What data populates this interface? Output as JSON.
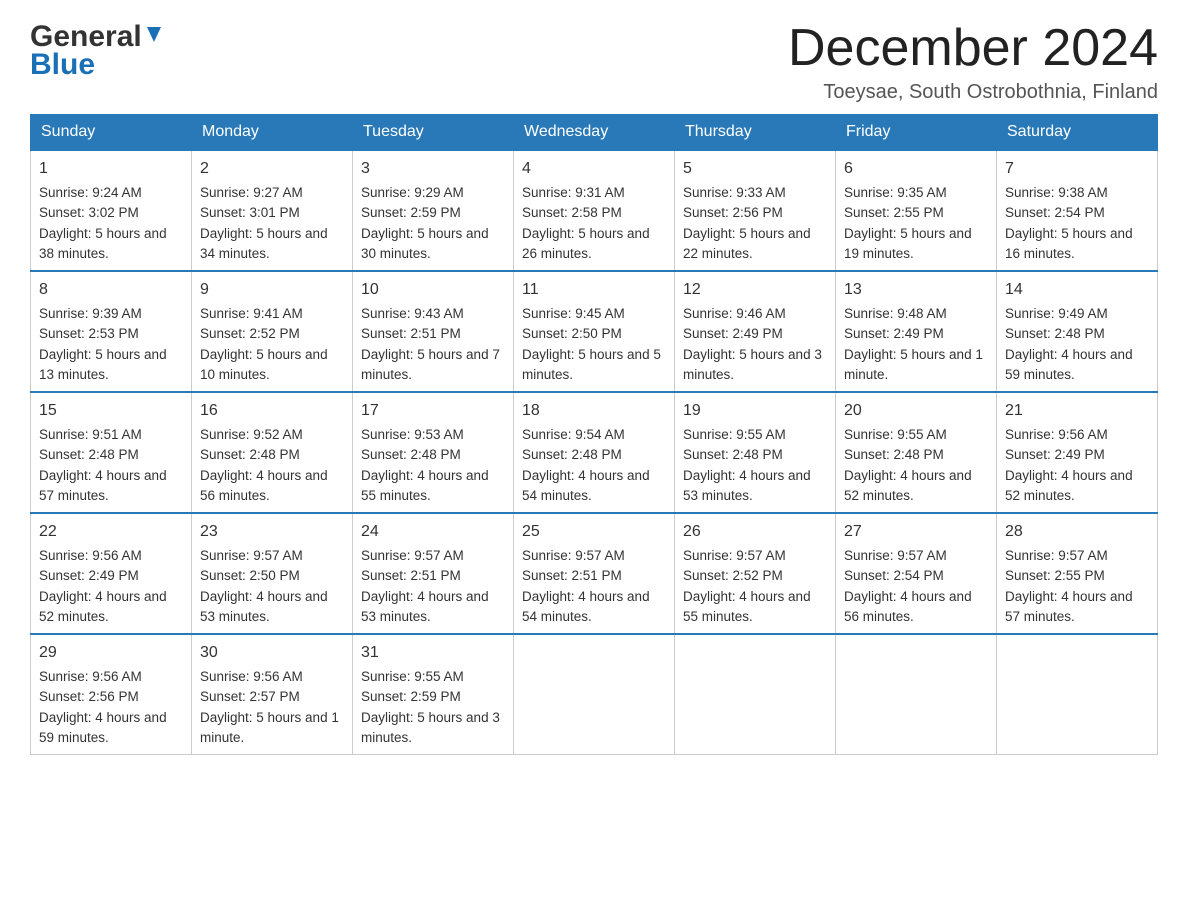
{
  "header": {
    "logo_general": "General",
    "logo_blue": "Blue",
    "month_title": "December 2024",
    "location": "Toeysae, South Ostrobothnia, Finland"
  },
  "days_of_week": [
    "Sunday",
    "Monday",
    "Tuesday",
    "Wednesday",
    "Thursday",
    "Friday",
    "Saturday"
  ],
  "weeks": [
    [
      {
        "day": "1",
        "sunrise": "9:24 AM",
        "sunset": "3:02 PM",
        "daylight": "5 hours and 38 minutes."
      },
      {
        "day": "2",
        "sunrise": "9:27 AM",
        "sunset": "3:01 PM",
        "daylight": "5 hours and 34 minutes."
      },
      {
        "day": "3",
        "sunrise": "9:29 AM",
        "sunset": "2:59 PM",
        "daylight": "5 hours and 30 minutes."
      },
      {
        "day": "4",
        "sunrise": "9:31 AM",
        "sunset": "2:58 PM",
        "daylight": "5 hours and 26 minutes."
      },
      {
        "day": "5",
        "sunrise": "9:33 AM",
        "sunset": "2:56 PM",
        "daylight": "5 hours and 22 minutes."
      },
      {
        "day": "6",
        "sunrise": "9:35 AM",
        "sunset": "2:55 PM",
        "daylight": "5 hours and 19 minutes."
      },
      {
        "day": "7",
        "sunrise": "9:38 AM",
        "sunset": "2:54 PM",
        "daylight": "5 hours and 16 minutes."
      }
    ],
    [
      {
        "day": "8",
        "sunrise": "9:39 AM",
        "sunset": "2:53 PM",
        "daylight": "5 hours and 13 minutes."
      },
      {
        "day": "9",
        "sunrise": "9:41 AM",
        "sunset": "2:52 PM",
        "daylight": "5 hours and 10 minutes."
      },
      {
        "day": "10",
        "sunrise": "9:43 AM",
        "sunset": "2:51 PM",
        "daylight": "5 hours and 7 minutes."
      },
      {
        "day": "11",
        "sunrise": "9:45 AM",
        "sunset": "2:50 PM",
        "daylight": "5 hours and 5 minutes."
      },
      {
        "day": "12",
        "sunrise": "9:46 AM",
        "sunset": "2:49 PM",
        "daylight": "5 hours and 3 minutes."
      },
      {
        "day": "13",
        "sunrise": "9:48 AM",
        "sunset": "2:49 PM",
        "daylight": "5 hours and 1 minute."
      },
      {
        "day": "14",
        "sunrise": "9:49 AM",
        "sunset": "2:48 PM",
        "daylight": "4 hours and 59 minutes."
      }
    ],
    [
      {
        "day": "15",
        "sunrise": "9:51 AM",
        "sunset": "2:48 PM",
        "daylight": "4 hours and 57 minutes."
      },
      {
        "day": "16",
        "sunrise": "9:52 AM",
        "sunset": "2:48 PM",
        "daylight": "4 hours and 56 minutes."
      },
      {
        "day": "17",
        "sunrise": "9:53 AM",
        "sunset": "2:48 PM",
        "daylight": "4 hours and 55 minutes."
      },
      {
        "day": "18",
        "sunrise": "9:54 AM",
        "sunset": "2:48 PM",
        "daylight": "4 hours and 54 minutes."
      },
      {
        "day": "19",
        "sunrise": "9:55 AM",
        "sunset": "2:48 PM",
        "daylight": "4 hours and 53 minutes."
      },
      {
        "day": "20",
        "sunrise": "9:55 AM",
        "sunset": "2:48 PM",
        "daylight": "4 hours and 52 minutes."
      },
      {
        "day": "21",
        "sunrise": "9:56 AM",
        "sunset": "2:49 PM",
        "daylight": "4 hours and 52 minutes."
      }
    ],
    [
      {
        "day": "22",
        "sunrise": "9:56 AM",
        "sunset": "2:49 PM",
        "daylight": "4 hours and 52 minutes."
      },
      {
        "day": "23",
        "sunrise": "9:57 AM",
        "sunset": "2:50 PM",
        "daylight": "4 hours and 53 minutes."
      },
      {
        "day": "24",
        "sunrise": "9:57 AM",
        "sunset": "2:51 PM",
        "daylight": "4 hours and 53 minutes."
      },
      {
        "day": "25",
        "sunrise": "9:57 AM",
        "sunset": "2:51 PM",
        "daylight": "4 hours and 54 minutes."
      },
      {
        "day": "26",
        "sunrise": "9:57 AM",
        "sunset": "2:52 PM",
        "daylight": "4 hours and 55 minutes."
      },
      {
        "day": "27",
        "sunrise": "9:57 AM",
        "sunset": "2:54 PM",
        "daylight": "4 hours and 56 minutes."
      },
      {
        "day": "28",
        "sunrise": "9:57 AM",
        "sunset": "2:55 PM",
        "daylight": "4 hours and 57 minutes."
      }
    ],
    [
      {
        "day": "29",
        "sunrise": "9:56 AM",
        "sunset": "2:56 PM",
        "daylight": "4 hours and 59 minutes."
      },
      {
        "day": "30",
        "sunrise": "9:56 AM",
        "sunset": "2:57 PM",
        "daylight": "5 hours and 1 minute."
      },
      {
        "day": "31",
        "sunrise": "9:55 AM",
        "sunset": "2:59 PM",
        "daylight": "5 hours and 3 minutes."
      },
      null,
      null,
      null,
      null
    ]
  ],
  "labels": {
    "sunrise": "Sunrise:",
    "sunset": "Sunset:",
    "daylight": "Daylight:"
  },
  "colors": {
    "header_bg": "#2979b8",
    "header_text": "#ffffff",
    "border": "#2979b8"
  }
}
